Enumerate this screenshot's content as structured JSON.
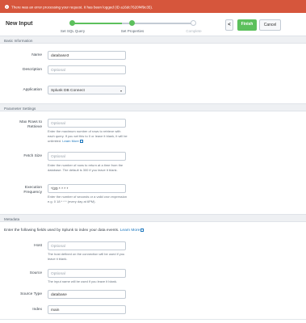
{
  "error": {
    "message": "There was an error processing your request. It has been logged (ID a16dc7620f4f9c35)."
  },
  "header": {
    "title": "New Input",
    "steps": [
      {
        "label": "Set SQL Query",
        "state": "done"
      },
      {
        "label": "Set Properties",
        "state": "active"
      },
      {
        "label": "Complete",
        "state": "pending"
      }
    ],
    "prev_label": "<",
    "finish_label": "Finish",
    "cancel_label": "Cancel"
  },
  "colors": {
    "accent_green": "#5cc05c",
    "error_red": "#d6563c",
    "link_blue": "#1a75bc"
  },
  "basic": {
    "section_title": "Basic Information",
    "name_label": "Name",
    "name_value": "database3",
    "description_label": "Description",
    "description_placeholder": "Optional",
    "application_label": "Application",
    "application_value": "Splunk DB Connect"
  },
  "params": {
    "section_title": "Parameter Settings",
    "max_rows_label": "Max Rows to Retrieve",
    "max_rows_placeholder": "Optional",
    "max_rows_help": "Enter the maximum number of rows to retrieve with each query. If you set this to 0 or leave it blank, it will be unlimited.",
    "learn_more": "Learn More",
    "fetch_size_label": "Fetch Size",
    "fetch_size_placeholder": "Optional",
    "fetch_size_help": "Enter the number of rows to return at a time from the database. The default is 300 if you leave it blank.",
    "exec_freq_label": "Execution Frequency",
    "exec_freq_value": "*/20 * * * *",
    "exec_freq_help": "Enter the number of seconds or a valid cron expression e.g. 0 18 * * * (every day at 6PM)."
  },
  "metadata": {
    "section_title": "Metadata",
    "intro": "Enter the following fields used by Splunk to index your data events.",
    "learn_more": "Learn More",
    "host_label": "Host",
    "host_placeholder": "Optional",
    "host_help": "The host defined on the connection will be used if you leave it blank.",
    "source_label": "Source",
    "source_placeholder": "Optional",
    "source_help": "The input name will be used if you leave it blank.",
    "sourcetype_label": "Source Type",
    "sourcetype_value": "database",
    "index_label": "Index",
    "index_value": "main"
  }
}
